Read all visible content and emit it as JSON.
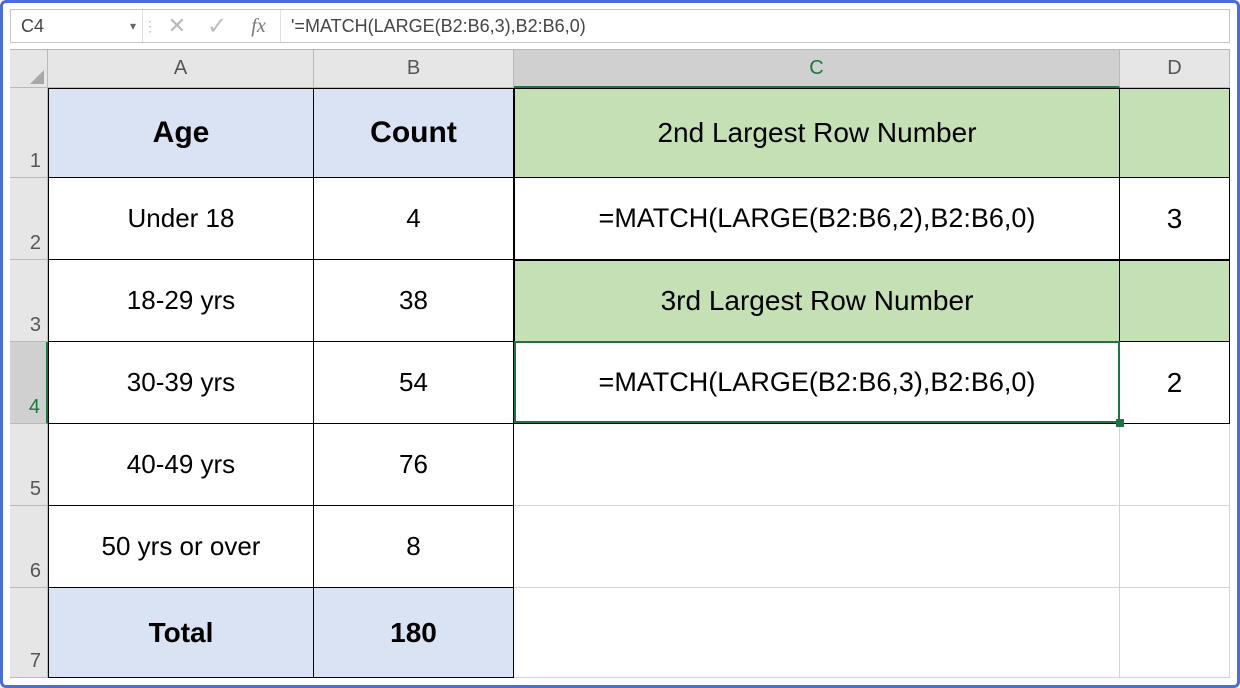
{
  "formula_bar": {
    "namebox": "C4",
    "fx_label": "fx",
    "formula_text": "'=MATCH(LARGE(B2:B6,3),B2:B6,0)"
  },
  "columns": {
    "A": "A",
    "B": "B",
    "C": "C",
    "D": "D"
  },
  "row_numbers": [
    "1",
    "2",
    "3",
    "4",
    "5",
    "6",
    "7"
  ],
  "table": {
    "headers": {
      "age": "Age",
      "count": "Count"
    },
    "rows": [
      {
        "age": "Under 18",
        "count": "4"
      },
      {
        "age": "18-29 yrs",
        "count": "38"
      },
      {
        "age": "30-39 yrs",
        "count": "54"
      },
      {
        "age": "40-49 yrs",
        "count": "76"
      },
      {
        "age": "50 yrs or over",
        "count": "8"
      }
    ],
    "total_label": "Total",
    "total_value": "180"
  },
  "panel": {
    "title_2nd": "2nd Largest Row Number",
    "formula_2nd": "=MATCH(LARGE(B2:B6,2),B2:B6,0)",
    "result_2nd": "3",
    "title_3rd": "3rd Largest Row Number",
    "formula_3rd": "=MATCH(LARGE(B2:B6,3),B2:B6,0)",
    "result_3rd": "2"
  },
  "selected_cell": "C4"
}
